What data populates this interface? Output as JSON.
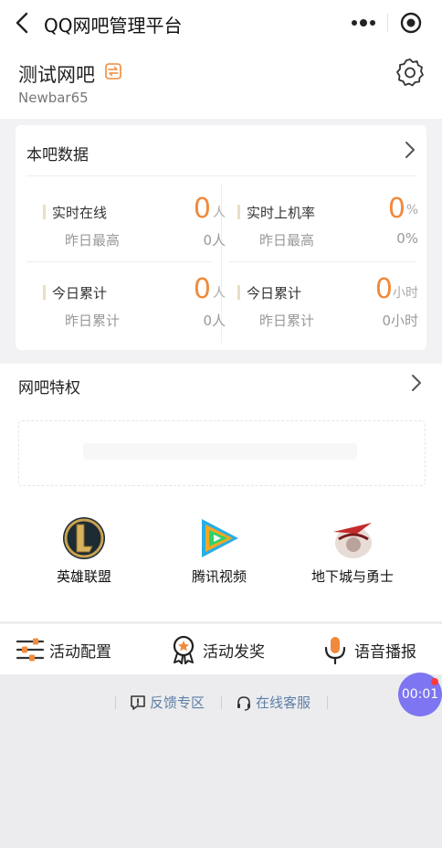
{
  "nav": {
    "title": "QQ网吧管理平台",
    "back_icon": "chevron-left-icon",
    "more_icon": "more-dots-icon",
    "target_icon": "target-icon"
  },
  "header": {
    "bar_name": "测试网吧",
    "bar_id": "Newbar65",
    "switch_icon": "switch-icon",
    "settings_icon": "gear-icon"
  },
  "stats": {
    "title": "本吧数据",
    "cells": [
      {
        "label": "实时在线",
        "value": "0",
        "unit": "人",
        "sub_label": "昨日最高",
        "sub_value": "0人"
      },
      {
        "label": "实时上机率",
        "value": "0",
        "unit": "%",
        "sub_label": "昨日最高",
        "sub_value": "0%"
      },
      {
        "label": "今日累计",
        "value": "0",
        "unit": "人",
        "sub_label": "昨日累计",
        "sub_value": "0人"
      },
      {
        "label": "今日累计",
        "value": "0",
        "unit": "小时",
        "sub_label": "昨日累计",
        "sub_value": "0小时"
      }
    ]
  },
  "privileges": {
    "title": "网吧特权",
    "games": [
      {
        "name": "英雄联盟",
        "icon": "league-of-legends-icon"
      },
      {
        "name": "腾讯视频",
        "icon": "tencent-video-icon"
      },
      {
        "name": "地下城与勇士",
        "icon": "dnf-icon"
      }
    ]
  },
  "toolbar": {
    "items": [
      {
        "label": "活动配置",
        "icon": "sliders-icon"
      },
      {
        "label": "活动发奖",
        "icon": "award-icon"
      },
      {
        "label": "语音播报",
        "icon": "microphone-icon"
      }
    ]
  },
  "footer": {
    "feedback": "反馈专区",
    "support": "在线客服"
  },
  "timer": {
    "text": "00:01"
  },
  "colors": {
    "accent": "#f08a3c",
    "link": "#5e7fa6",
    "timer_bg": "#7d75f2"
  }
}
